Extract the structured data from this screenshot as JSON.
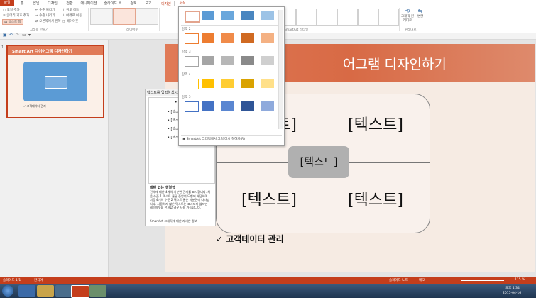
{
  "tabs": [
    "파일",
    "홈",
    "삽입",
    "디자인",
    "전환",
    "애니메이션",
    "슬라이드 쇼",
    "검토",
    "보기",
    "디자인",
    "서식"
  ],
  "ribbon": {
    "add_shape": "도형 추가",
    "add_bullet": "글머리 기호 추가",
    "text_pane": "텍스트 창",
    "promote": "수준 올리기",
    "demote": "수준 내리기",
    "move_up": "위로 이동",
    "move_down": "아래로 이동",
    "rtl": "오른쪽에서 왼쪽",
    "layout_btn": "레이아웃",
    "group_create": "그래픽 만들기",
    "group_layouts": "레이아웃",
    "change_colors": "색 변경",
    "group_styles": "SmartArt 스타일",
    "reset_graphic": "그래픽 원래대로",
    "convert": "변환",
    "group_reset": "원래대로"
  },
  "dropdown": {
    "rows": [
      "강조 2",
      "강조 3",
      "강조 4",
      "강조 5"
    ],
    "footer": "SmartArt 그래픽에서 그림 다시 칠하기(R)"
  },
  "thumb": {
    "title": "Smart Art 다이어그램 디자인하기",
    "note": "고객데이터 관리"
  },
  "slide": {
    "title_visible": "어그램 디자인하기",
    "cell_tl": "[텍스트]",
    "cell_tr": "[텍스트]",
    "cell_bl": "[텍스트]",
    "cell_br": "[텍스트]",
    "center": "[텍스트]",
    "bullet": "고객데이터 관리"
  },
  "textpane": {
    "title": "텍스트를 입력하십시오",
    "items": [
      "[텍스",
      "[텍스",
      "[텍스",
      "[텍스"
    ],
    "desc_title": "패턴 있는 행렬형",
    "desc_body": "전체에 대한 4개의 사분면 관계를 표시합니다. 처음 수준 1 텍스트 줄은 중앙의 도형에 해당하며 처음 4개의 수준 2 텍스트 줄은 사분면에 나타납니다. 사용하지 않은 텍스트는 표시되지 않지만 레이아웃을 전환할 경우 사용 가능합니다.",
    "link": "SmartArt 그래픽에 대한 자세한 정보"
  },
  "status": {
    "slide": "슬라이드 1/1",
    "lang": "한국어",
    "notes": "슬라이드 노트",
    "comments": "메모",
    "zoom": "115 %"
  },
  "taskbar": {
    "time": "오후 4:34",
    "date": "2015-04-16"
  },
  "colors": {
    "accent": "#c43e1c",
    "smart_blue": "#5b9bd5",
    "orange": "#ed7d31",
    "gray": "#a5a5a5",
    "gold": "#ffc000"
  }
}
